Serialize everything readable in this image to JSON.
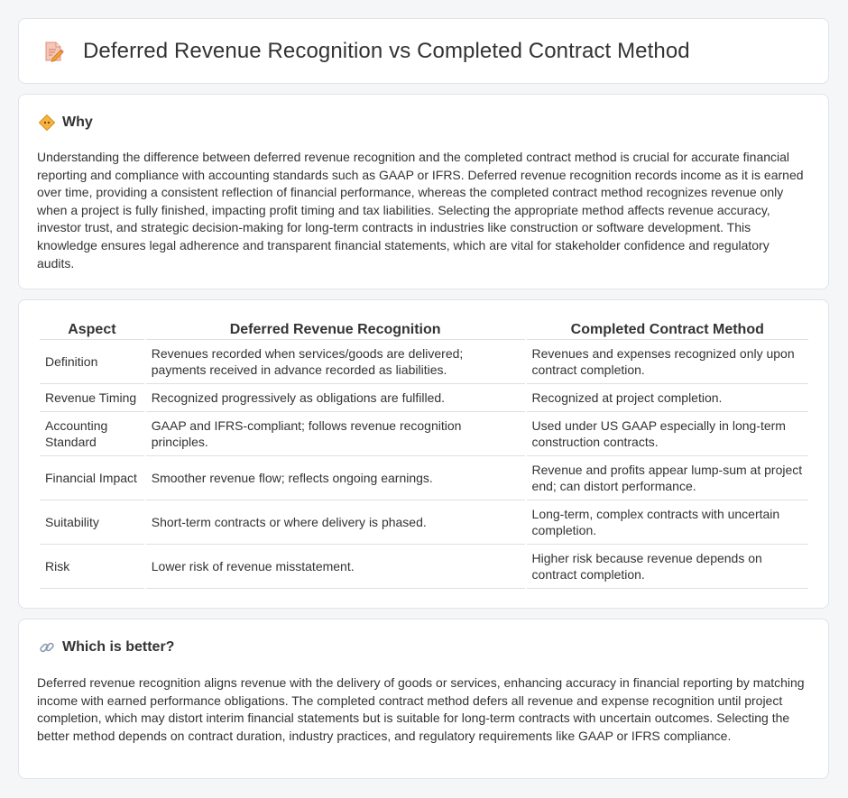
{
  "header": {
    "title": "Deferred Revenue Recognition vs Completed Contract Method",
    "icon": "document-pencil-icon"
  },
  "why": {
    "icon": "diamond-icon",
    "title": "Why",
    "body": "Understanding the difference between deferred revenue recognition and the completed contract method is crucial for accurate financial reporting and compliance with accounting standards such as GAAP or IFRS. Deferred revenue recognition records income as it is earned over time, providing a consistent reflection of financial performance, whereas the completed contract method recognizes revenue only when a project is fully finished, impacting profit timing and tax liabilities. Selecting the appropriate method affects revenue accuracy, investor trust, and strategic decision-making for long-term contracts in industries like construction or software development. This knowledge ensures legal adherence and transparent financial statements, which are vital for stakeholder confidence and regulatory audits."
  },
  "table": {
    "headers": [
      "Aspect",
      "Deferred Revenue Recognition",
      "Completed Contract Method"
    ],
    "rows": [
      [
        "Definition",
        "Revenues recorded when services/goods are delivered; payments received in advance recorded as liabilities.",
        "Revenues and expenses recognized only upon contract completion."
      ],
      [
        "Revenue Timing",
        "Recognized progressively as obligations are fulfilled.",
        "Recognized at project completion."
      ],
      [
        "Accounting Standard",
        "GAAP and IFRS-compliant; follows revenue recognition principles.",
        "Used under US GAAP especially in long-term construction contracts."
      ],
      [
        "Financial Impact",
        "Smoother revenue flow; reflects ongoing earnings.",
        "Revenue and profits appear lump-sum at project end; can distort performance."
      ],
      [
        "Suitability",
        "Short-term contracts or where delivery is phased.",
        "Long-term, complex contracts with uncertain completion."
      ],
      [
        "Risk",
        "Lower risk of revenue misstatement.",
        "Higher risk because revenue depends on contract completion."
      ]
    ]
  },
  "better": {
    "icon": "link-icon",
    "title": "Which is better?",
    "body": "Deferred revenue recognition aligns revenue with the delivery of goods or services, enhancing accuracy in financial reporting by matching income with earned performance obligations. The completed contract method defers all revenue and expense recognition until project completion, which may distort interim financial statements but is suitable for long-term contracts with uncertain outcomes. Selecting the better method depends on contract duration, industry practices, and regulatory requirements like GAAP or IFRS compliance."
  },
  "colors": {
    "background": "#f5f6f8",
    "card": "#ffffff",
    "border": "#e1e4e8",
    "text": "#333333",
    "icon_orange": "#f0a030",
    "icon_pink": "#e57373"
  }
}
